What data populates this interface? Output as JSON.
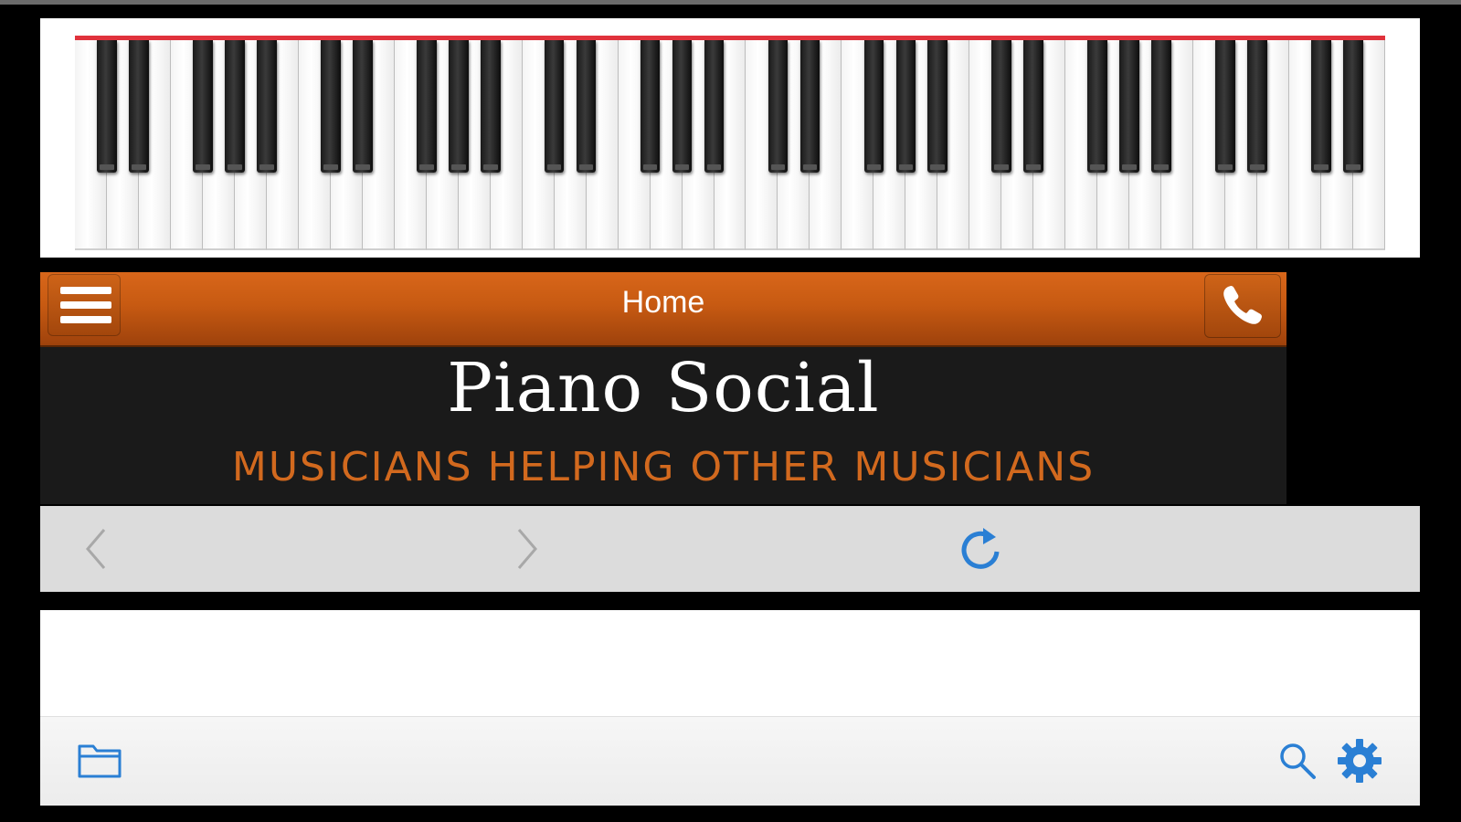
{
  "app": {
    "nav_title": "Home",
    "site_title": "Piano Social",
    "tagline": "MUSICIANS HELPING OTHER MUSICIANS"
  },
  "icons": {
    "menu": "hamburger-menu-icon",
    "call": "phone-icon",
    "back": "chevron-left-icon",
    "forward": "chevron-right-icon",
    "reload": "reload-icon",
    "folder": "folder-icon",
    "search": "search-icon",
    "settings": "gear-icon"
  },
  "colors": {
    "nav_orange": "#c75a12",
    "tagline_orange": "#d2691e",
    "piano_top_line": "#e0323c",
    "ios_blue": "#2a7fd4",
    "disabled_gray": "#a8a8a8"
  }
}
